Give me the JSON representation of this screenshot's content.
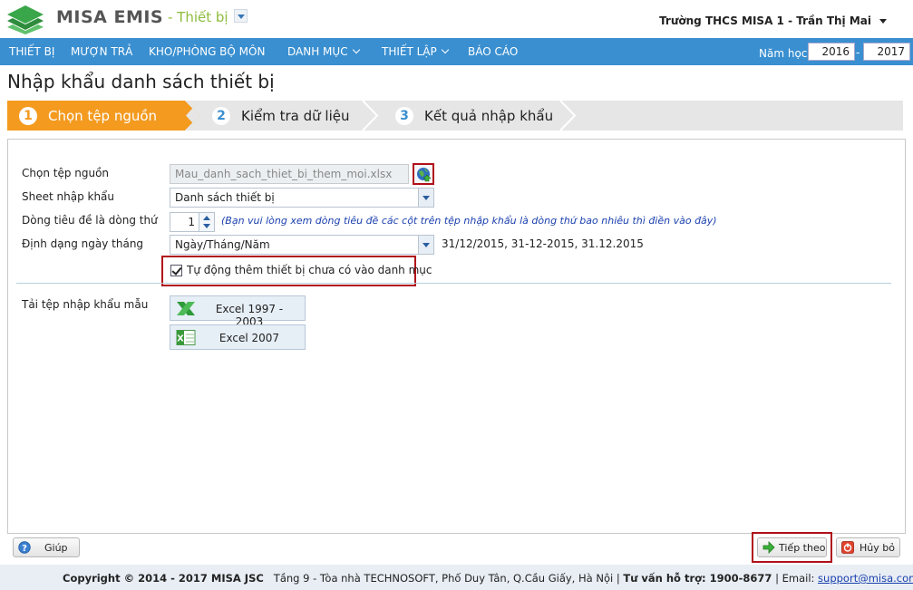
{
  "app": {
    "brand": "MISA EMIS",
    "module": "- Thiết bị",
    "user": "Trường THCS MISA 1 - Trần Thị Mai"
  },
  "menu": {
    "items": [
      {
        "label": "THIẾT BỊ",
        "has_dropdown": false
      },
      {
        "label": "MƯỢN TRẢ",
        "has_dropdown": false
      },
      {
        "label": "KHO/PHÒNG BỘ MÔN",
        "has_dropdown": false
      },
      {
        "label": "DANH MỤC",
        "has_dropdown": true
      },
      {
        "label": "THIẾT LẬP",
        "has_dropdown": true
      },
      {
        "label": "BÁO CÁO",
        "has_dropdown": false
      }
    ],
    "year_label": "Năm học:",
    "year_from": "2016",
    "year_separator": "-",
    "year_to": "2017"
  },
  "page": {
    "title": "Nhập khẩu danh sách thiết bị"
  },
  "wizard": {
    "steps": [
      {
        "number": "1",
        "label": "Chọn tệp nguồn",
        "active": true
      },
      {
        "number": "2",
        "label": "Kiểm tra dữ liệu",
        "active": false
      },
      {
        "number": "3",
        "label": "Kết quả nhập khẩu",
        "active": false
      }
    ],
    "active_color": "#f39a1f",
    "inactive_color": "#e6e6e6"
  },
  "form": {
    "source_file_label": "Chọn tệp nguồn",
    "source_file_value": "Mau_danh_sach_thiet_bi_them_moi.xlsx",
    "sheet_label": "Sheet nhập khẩu",
    "sheet_value": "Danh sách thiết bị",
    "header_row_label": "Dòng tiêu đề là dòng thứ",
    "header_row_value": "1",
    "header_row_hint": "(Bạn vui lòng xem dòng tiêu đề các cột trên tệp nhập khẩu là dòng thứ bao nhiêu thì điền vào đây)",
    "date_format_label": "Định dạng ngày tháng",
    "date_format_value": "Ngày/Tháng/Năm",
    "date_format_examples": "31/12/2015, 31-12-2015, 31.12.2015",
    "auto_add_checked": true,
    "auto_add_label": "Tự động thêm thiết bị chưa có vào danh mục"
  },
  "templates": {
    "label": "Tải tệp nhập khẩu mẫu",
    "excel_old": "Excel 1997 - 2003",
    "excel_new": "Excel 2007"
  },
  "buttons": {
    "help": "Giúp",
    "next": "Tiếp theo",
    "cancel": "Hủy bỏ"
  },
  "footer": {
    "copyright": "Copyright © 2014 - 2017 MISA JSC",
    "address": "Tầng 9 - Tòa nhà TECHNOSOFT, Phố Duy Tân, Q.Cầu Giấy, Hà Nội |",
    "support_label": "Tư vấn hỗ trợ: 1900-8677",
    "email_label": "| Email:",
    "email": "support@misa.com.vn"
  },
  "colors": {
    "menubar": "#3a8fd0",
    "accent_orange": "#f39a1f",
    "highlight_red": "#b0101a",
    "brand_green": "#8dbd3a"
  }
}
